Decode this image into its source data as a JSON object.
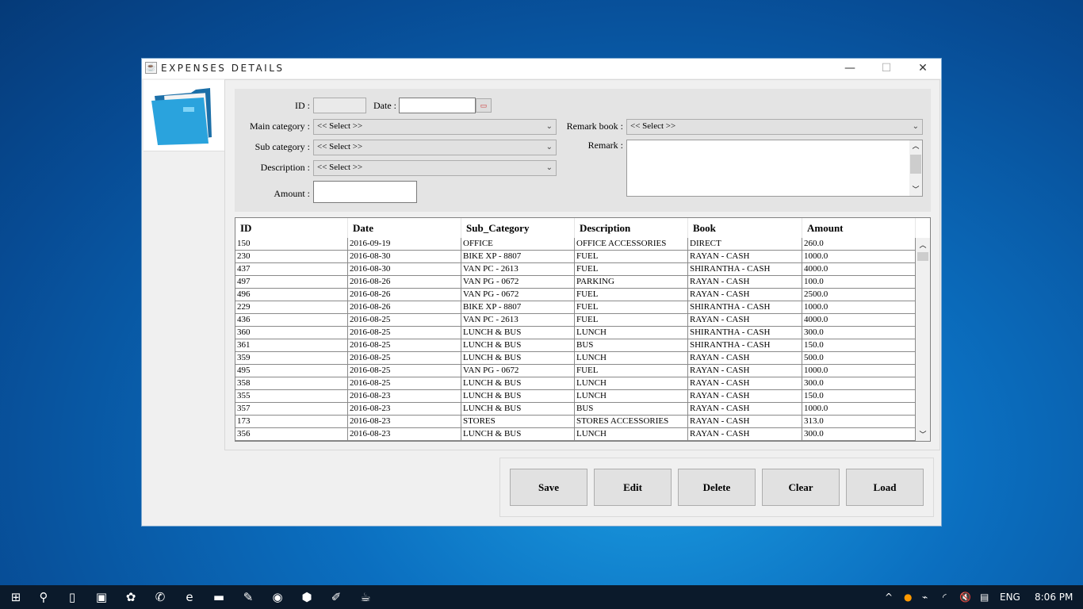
{
  "window": {
    "title": "EXPENSES DETAILS",
    "minimize": "—",
    "maximize": "☐",
    "close": "✕"
  },
  "form": {
    "id_label": "ID :",
    "id_value": "",
    "date_label": "Date :",
    "date_value": "",
    "main_category_label": "Main category :",
    "main_category_value": "<< Select >>",
    "sub_category_label": "Sub category :",
    "sub_category_value": "<< Select >>",
    "description_label": "Description :",
    "description_value": "<< Select >>",
    "amount_label": "Amount :",
    "amount_value": "",
    "remark_book_label": "Remark book :",
    "remark_book_value": "<< Select >>",
    "remark_label": "Remark :",
    "remark_value": ""
  },
  "table": {
    "columns": [
      "ID",
      "Date",
      "Sub_Category",
      "Description",
      "Book",
      "Amount"
    ],
    "rows": [
      [
        "150",
        "2016-09-19",
        "OFFICE",
        "OFFICE  ACCESSORIES",
        "DIRECT",
        "260.0"
      ],
      [
        "230",
        "2016-08-30",
        "BIKE  XP - 8807",
        "FUEL",
        "RAYAN - CASH",
        "1000.0"
      ],
      [
        "437",
        "2016-08-30",
        "VAN  PC - 2613",
        "FUEL",
        "SHIRANTHA - CASH",
        "4000.0"
      ],
      [
        "497",
        "2016-08-26",
        "VAN  PG - 0672",
        "PARKING",
        "RAYAN - CASH",
        "100.0"
      ],
      [
        "496",
        "2016-08-26",
        "VAN  PG - 0672",
        "FUEL",
        "RAYAN - CASH",
        "2500.0"
      ],
      [
        "229",
        "2016-08-26",
        "BIKE  XP - 8807",
        "FUEL",
        "SHIRANTHA - CASH",
        "1000.0"
      ],
      [
        "436",
        "2016-08-25",
        "VAN  PC - 2613",
        "FUEL",
        "RAYAN - CASH",
        "4000.0"
      ],
      [
        "360",
        "2016-08-25",
        "LUNCH & BUS",
        "LUNCH",
        "SHIRANTHA - CASH",
        "300.0"
      ],
      [
        "361",
        "2016-08-25",
        "LUNCH & BUS",
        "BUS",
        "SHIRANTHA - CASH",
        "150.0"
      ],
      [
        "359",
        "2016-08-25",
        "LUNCH & BUS",
        "LUNCH",
        "RAYAN - CASH",
        "500.0"
      ],
      [
        "495",
        "2016-08-25",
        "VAN  PG - 0672",
        "FUEL",
        "RAYAN - CASH",
        "1000.0"
      ],
      [
        "358",
        "2016-08-25",
        "LUNCH & BUS",
        "LUNCH",
        "RAYAN - CASH",
        "300.0"
      ],
      [
        "355",
        "2016-08-23",
        "LUNCH & BUS",
        "LUNCH",
        "RAYAN - CASH",
        "150.0"
      ],
      [
        "357",
        "2016-08-23",
        "LUNCH & BUS",
        "BUS",
        "RAYAN - CASH",
        "1000.0"
      ],
      [
        "173",
        "2016-08-23",
        "STORES",
        "STORES  ACCESSORIES",
        "RAYAN - CASH",
        "313.0"
      ],
      [
        "356",
        "2016-08-23",
        "LUNCH & BUS",
        "LUNCH",
        "RAYAN - CASH",
        "300.0"
      ]
    ]
  },
  "buttons": {
    "save": "Save",
    "edit": "Edit",
    "delete": "Delete",
    "clear": "Clear",
    "load": "Load"
  },
  "taskbar": {
    "language": "ENG",
    "time": "8:06 PM",
    "apps": [
      "start-icon",
      "search-icon",
      "task-view-icon",
      "store-icon",
      "paint-icon",
      "viber-icon",
      "edge-icon",
      "file-explorer-icon",
      "notepad-icon",
      "chrome-icon",
      "virtualbox-icon",
      "paint-brush-icon",
      "java-app-icon"
    ]
  },
  "colors": {
    "desktop": "#0b6fc0",
    "taskbar": "#0b1a2b",
    "window_bg": "#f0f0f0",
    "button_bg": "#e1e1e1"
  }
}
